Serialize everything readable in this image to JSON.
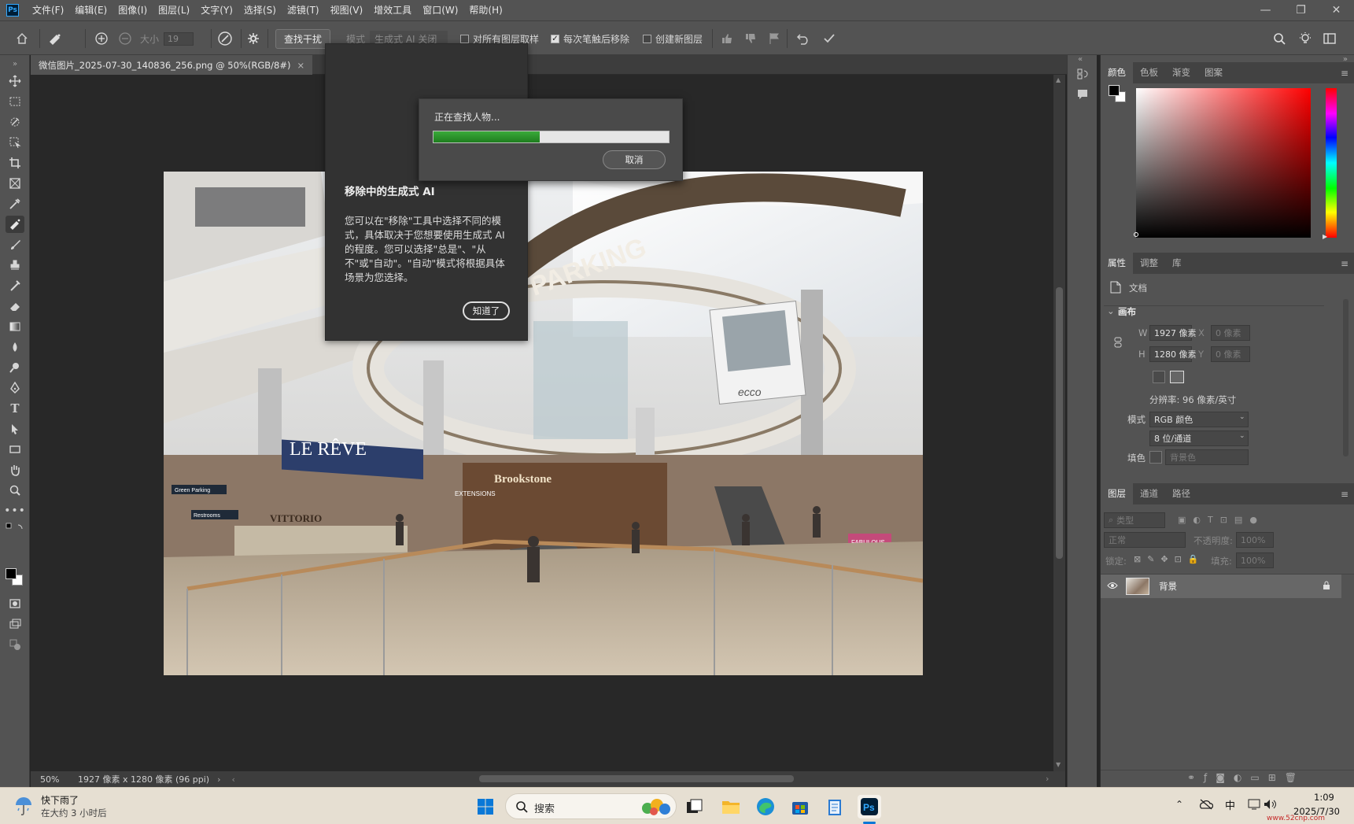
{
  "app": {
    "logo": "Ps",
    "menu": [
      "文件(F)",
      "编辑(E)",
      "图像(I)",
      "图层(L)",
      "文字(Y)",
      "选择(S)",
      "滤镜(T)",
      "视图(V)",
      "增效工具",
      "窗口(W)",
      "帮助(H)"
    ],
    "window_controls": [
      "—",
      "❐",
      "✕"
    ]
  },
  "options": {
    "size_label": "大小",
    "size_value": "19",
    "find_distractions": "查找干扰",
    "mode_label": "模式",
    "mode_value": "生成式 AI 关闭",
    "sample_all_layers": "对所有图层取样",
    "remove_after_stroke": "每次笔触后移除",
    "new_layer": "创建新图层"
  },
  "document": {
    "tab_title": "微信图片_2025-07-30_140836_256.png @ 50%(RGB/8#)",
    "zoom": "50%",
    "info": "1927 像素 x 1280 像素 (96 ppi)"
  },
  "image_text": {
    "parking": "PARKING",
    "lereve": "LE RÊVE",
    "vittorio": "VITTORIO",
    "brookstone": "Brookstone",
    "ecco": "ecco",
    "extensions": "EXTENSIONS",
    "green_parking": "Green Parking",
    "restrooms": "Restrooms",
    "fabulous": "FABULOUS"
  },
  "genai_popup": {
    "title": "移除中的生成式 AI",
    "body": "您可以在\"移除\"工具中选择不同的模式，具体取决于您想要使用生成式 AI 的程度。您可以选择\"总是\"、\"从不\"或\"自动\"。\"自动\"模式将根据具体场景为您选择。",
    "button": "知道了"
  },
  "progress_dialog": {
    "message": "正在查找人物...",
    "progress": 0.45,
    "cancel": "取消"
  },
  "color_panel": {
    "tabs": [
      "颜色",
      "色板",
      "渐变",
      "图案"
    ],
    "foreground": "#000000",
    "background": "#ffffff",
    "hue_color": "#ff0000"
  },
  "properties_panel": {
    "tabs": [
      "属性",
      "调整",
      "库"
    ],
    "doc_label": "文档",
    "section": "画布",
    "w_label": "W",
    "w_value": "1927 像素",
    "h_label": "H",
    "h_value": "1280 像素",
    "x_label": "X",
    "x_value": "0 像素",
    "y_label": "Y",
    "y_value": "0 像素",
    "resolution": "分辨率: 96 像素/英寸",
    "mode_label": "模式",
    "mode_value": "RGB 颜色",
    "depth_value": "8 位/通道",
    "fill_label": "填色",
    "fill_value": "背景色"
  },
  "layers_panel": {
    "tabs": [
      "图层",
      "通道",
      "路径"
    ],
    "kind_filter": "类型",
    "blend_mode": "正常",
    "opacity_label": "不透明度:",
    "opacity_value": "100%",
    "lock_label": "锁定:",
    "fill_label": "填充:",
    "fill_value": "100%",
    "layer_name": "背景"
  },
  "taskbar": {
    "weather_title": "快下雨了",
    "weather_sub": "在大约 3 小时后",
    "search": "搜索",
    "ime": "中",
    "time": "1:09",
    "date": "2025/7/30",
    "watermark": "www.52cnp.com"
  }
}
